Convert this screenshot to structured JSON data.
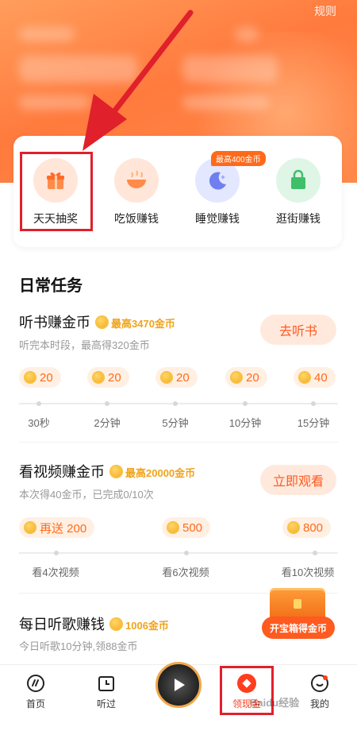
{
  "header": {
    "rules_label": "规则"
  },
  "quick_actions": [
    {
      "label": "天天抽奖",
      "icon": "gift-icon"
    },
    {
      "label": "吃饭赚钱",
      "icon": "bowl-icon"
    },
    {
      "label": "睡觉赚钱",
      "icon": "moon-icon",
      "badge": "最高400金币"
    },
    {
      "label": "逛街赚钱",
      "icon": "shopping-bag-icon"
    }
  ],
  "daily": {
    "title": "日常任务",
    "tasks": [
      {
        "title": "听书赚金币",
        "reward": "最高3470金币",
        "sub": "听完本时段，最高得320金币",
        "button": "去听书",
        "pills": [
          "20",
          "20",
          "20",
          "20",
          "40"
        ],
        "ticks": [
          "30秒",
          "2分钟",
          "5分钟",
          "10分钟",
          "15分钟"
        ]
      },
      {
        "title": "看视频赚金币",
        "reward": "最高20000金币",
        "sub": "本次得40金币，已完成0/10次",
        "button": "立即观看",
        "pills": [
          "再送 200",
          "500",
          "800"
        ],
        "ticks": [
          "看4次视频",
          "看6次视频",
          "看10次视频"
        ]
      },
      {
        "title": "每日听歌赚钱",
        "reward": "1006金币",
        "sub": "今日听歌10分钟,领88金币"
      }
    ]
  },
  "chest": {
    "label": "开宝箱得金币"
  },
  "tabs": [
    {
      "label": "首页",
      "icon": "home-gauge-icon"
    },
    {
      "label": "听过",
      "icon": "history-icon"
    },
    {
      "label": "",
      "icon": "play-icon"
    },
    {
      "label": "领现金",
      "icon": "cash-icon"
    },
    {
      "label": "我的",
      "icon": "profile-icon"
    }
  ],
  "watermark": "Baidu经验",
  "colors": {
    "accent": "#ff5a1f",
    "coin": "#f0a31b",
    "highlight": "#e0202b"
  }
}
